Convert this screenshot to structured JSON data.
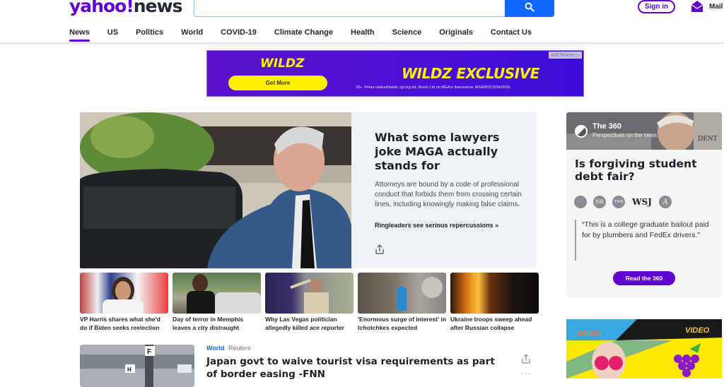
{
  "header": {
    "logo_primary": "yahoo!",
    "logo_secondary": "news",
    "search_placeholder": "",
    "search_icon": "search-icon",
    "signin_label": "Sign in",
    "mail_label": "Mail",
    "accent_color": "#6001d2"
  },
  "nav": {
    "items": [
      {
        "label": "News",
        "active": true
      },
      {
        "label": "US"
      },
      {
        "label": "Politics"
      },
      {
        "label": "World"
      },
      {
        "label": "COVID-19"
      },
      {
        "label": "Climate Change"
      },
      {
        "label": "Health"
      },
      {
        "label": "Science"
      },
      {
        "label": "Originals"
      },
      {
        "label": "Contact Us"
      }
    ]
  },
  "ad_banner": {
    "brand": "WILDZ",
    "button_label": "Get More",
    "headline": "WILDZ EXCLUSIVE",
    "fine_print": "18+. Pelaa vastuullisesti. rgl.org.mt. Rootz Ltd on MGA:n lisensoima: MGA/B2C/599/2018.",
    "adchoices_label": "AdChoices"
  },
  "hero": {
    "title": "What some lawyers joke MAGA actually stands for",
    "summary": "Attorneys are bound by a code of professional conduct that forbids them from crossing certain lines, including knowingly making false claims.",
    "link": "Ringleaders see serious repercussions »"
  },
  "thumbnails": [
    {
      "caption": "VP Harris shares what she'd do if Biden seeks reelection"
    },
    {
      "caption": "Day of terror in Memphis leaves a city distraught"
    },
    {
      "caption": "Why Las Vegas politician allegedly killed ace reporter"
    },
    {
      "caption": "'Enormous surge of interest' in tchotchkes expected"
    },
    {
      "caption": "Ukraine troops sweep ahead after Russian collapse"
    }
  ],
  "stream": {
    "category": "World",
    "source": "Reuters",
    "title": "Japan govt to waive tourist visa requirements as part of border easing -FNN",
    "more_label": "···"
  },
  "the360": {
    "name": "The 360",
    "tagline": "Perspectives on the news",
    "question": "Is forgiving student debt fair?",
    "publications": [
      "",
      "NR",
      "TNR",
      "WSJ",
      "A"
    ],
    "quote": "“This is a college graduate bailout paid for by plumbers and FedEx drivers.”",
    "button_label": "Read the 360"
  },
  "side_ad": {
    "badge_left": "BONUS",
    "badge_right": "VIDEO"
  }
}
